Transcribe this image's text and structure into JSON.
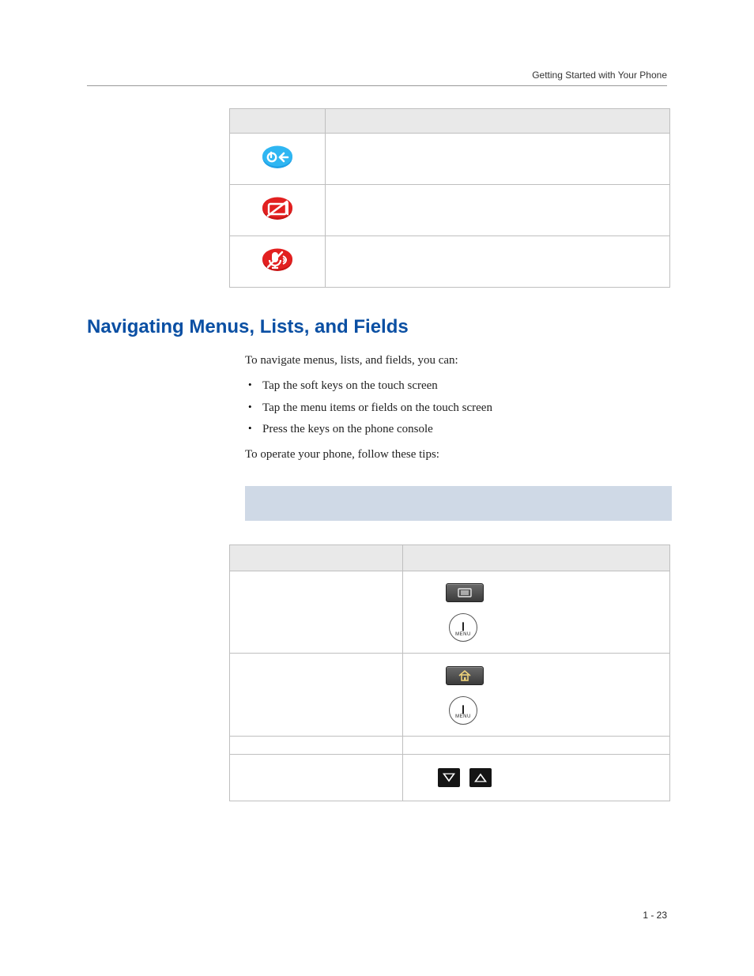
{
  "running_head": "Getting Started with Your Phone",
  "heading": "Navigating Menus, Lists, and Fields",
  "intro": "To navigate menus, lists, and fields, you can:",
  "bullets": [
    "Tap the soft keys on the touch screen",
    "Tap the menu items or fields on the touch screen",
    "Press the keys on the phone console"
  ],
  "tips_lead": "To operate your phone, follow these tips:",
  "menu_key_label": "MENU",
  "page_number": "1 - 23",
  "icons": {
    "login": "login-status-icon",
    "dnd": "do-not-disturb-icon",
    "mic_off": "microphone-muted-icon"
  }
}
